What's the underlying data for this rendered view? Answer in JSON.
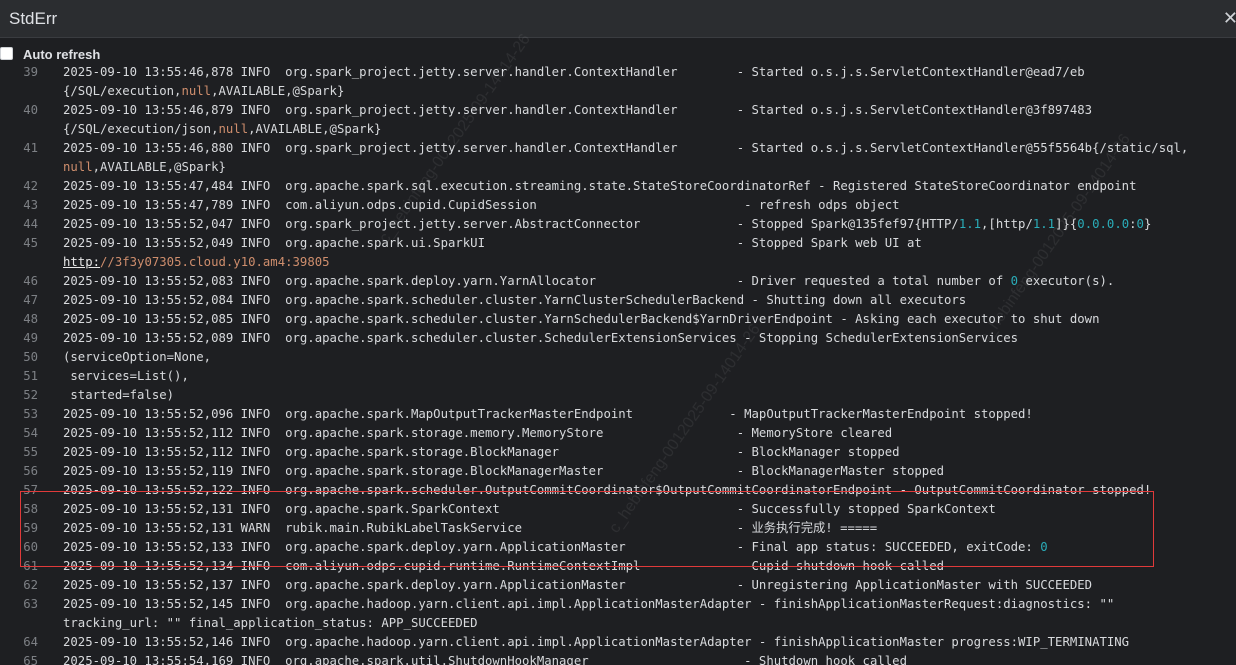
{
  "window": {
    "title": "StdErr",
    "close_glyph": "✕"
  },
  "toolbar": {
    "auto_refresh_label": "Auto refresh",
    "auto_refresh_checked": false
  },
  "watermark": {
    "text": "c_hebinfeng-0012025-09-14014-26"
  },
  "log_lines": [
    {
      "ln": "39",
      "html": "2025-09-10 13:55:46,878 INFO  org.spark_project.jetty.server.handler.ContextHandler        - Started o.s.j.s.ServletContextHandler@ead7/eb"
    },
    {
      "ln": "",
      "html": "{/SQL/execution,<span class=\"kw\">null</span>,AVAILABLE,@Spark}"
    },
    {
      "ln": "40",
      "html": "2025-09-10 13:55:46,879 INFO  org.spark_project.jetty.server.handler.ContextHandler        - Started o.s.j.s.ServletContextHandler@3f897483"
    },
    {
      "ln": "",
      "html": "{/SQL/execution/json,<span class=\"kw\">null</span>,AVAILABLE,@Spark}"
    },
    {
      "ln": "41",
      "html": "2025-09-10 13:55:46,880 INFO  org.spark_project.jetty.server.handler.ContextHandler        - Started o.s.j.s.ServletContextHandler@55f5564b{/static/sql,"
    },
    {
      "ln": "",
      "html": "<span class=\"kw\">null</span>,AVAILABLE,@Spark}"
    },
    {
      "ln": "42",
      "html": "2025-09-10 13:55:47,484 INFO  org.apache.spark.sql.execution.streaming.state.StateStoreCoordinatorRef - Registered StateStoreCoordinator endpoint"
    },
    {
      "ln": "43",
      "html": "2025-09-10 13:55:47,789 INFO  com.aliyun.odps.cupid.CupidSession                            - refresh odps object"
    },
    {
      "ln": "44",
      "html": "2025-09-10 13:55:52,047 INFO  org.spark_project.jetty.server.AbstractConnector             - Stopped Spark@135fef97{HTTP/<span class=\"num\">1.1</span>,[http/<span class=\"num\">1.1</span>]}{<span class=\"num\">0.0.0.0</span>:<span class=\"num\">0</span>}"
    },
    {
      "ln": "45",
      "html": "2025-09-10 13:55:52,049 INFO  org.apache.spark.ui.SparkUI                                  - Stopped Spark web UI at"
    },
    {
      "ln": "",
      "html": "<span class=\"url\">http:</span><span class=\"kw\">//3f3y07305.cloud.y10.am4:39805</span>"
    },
    {
      "ln": "46",
      "html": "2025-09-10 13:55:52,083 INFO  org.apache.spark.deploy.yarn.YarnAllocator                   - Driver requested a total number of <span class=\"num\">0</span> executor(s)."
    },
    {
      "ln": "47",
      "html": "2025-09-10 13:55:52,084 INFO  org.apache.spark.scheduler.cluster.YarnClusterSchedulerBackend - Shutting down all executors"
    },
    {
      "ln": "48",
      "html": "2025-09-10 13:55:52,085 INFO  org.apache.spark.scheduler.cluster.YarnSchedulerBackend$YarnDriverEndpoint - Asking each executor to shut down"
    },
    {
      "ln": "49",
      "html": "2025-09-10 13:55:52,089 INFO  org.apache.spark.scheduler.cluster.SchedulerExtensionServices - Stopping SchedulerExtensionServices"
    },
    {
      "ln": "50",
      "html": "(serviceOption=None,"
    },
    {
      "ln": "51",
      "html": " services=List(),"
    },
    {
      "ln": "52",
      "html": " started=false)"
    },
    {
      "ln": "53",
      "html": "2025-09-10 13:55:52,096 INFO  org.apache.spark.MapOutputTrackerMasterEndpoint             - MapOutputTrackerMasterEndpoint stopped!"
    },
    {
      "ln": "54",
      "html": "2025-09-10 13:55:52,112 INFO  org.apache.spark.storage.memory.MemoryStore                  - MemoryStore cleared"
    },
    {
      "ln": "55",
      "html": "2025-09-10 13:55:52,112 INFO  org.apache.spark.storage.BlockManager                        - BlockManager stopped"
    },
    {
      "ln": "56",
      "html": "2025-09-10 13:55:52,119 INFO  org.apache.spark.storage.BlockManagerMaster                  - BlockManagerMaster stopped"
    },
    {
      "ln": "57",
      "html": "2025-09-10 13:55:52,122 INFO  org.apache.spark.scheduler.OutputCommitCoordinator$OutputCommitCoordinatorEndpoint - OutputCommitCoordinator stopped!"
    },
    {
      "ln": "58",
      "html": "2025-09-10 13:55:52,131 INFO  org.apache.spark.SparkContext                                - Successfully stopped SparkContext"
    },
    {
      "ln": "59",
      "html": "2025-09-10 13:55:52,131 WARN  rubik.main.RubikLabelTaskService                             - 业务执行完成! ====="
    },
    {
      "ln": "60",
      "html": "2025-09-10 13:55:52,133 INFO  org.apache.spark.deploy.yarn.ApplicationMaster               - Final app status: SUCCEEDED, exitCode: <span class=\"num\">0</span>"
    },
    {
      "ln": "61",
      "html": "2025-09-10 13:55:52,134 INFO  com.aliyun.odps.cupid.runtime.RuntimeContextImpl             - Cupid shutdown hook called"
    },
    {
      "ln": "62",
      "html": "2025-09-10 13:55:52,137 INFO  org.apache.spark.deploy.yarn.ApplicationMaster               - Unregistering ApplicationMaster with SUCCEEDED"
    },
    {
      "ln": "63",
      "html": "2025-09-10 13:55:52,145 INFO  org.apache.hadoop.yarn.client.api.impl.ApplicationMasterAdapter - finishApplicationMasterRequest:diagnostics: \"\""
    },
    {
      "ln": "",
      "html": "tracking_url: \"\" final_application_status: APP_SUCCEEDED"
    },
    {
      "ln": "64",
      "html": "2025-09-10 13:55:52,146 INFO  org.apache.hadoop.yarn.client.api.impl.ApplicationMasterAdapter - finishApplicationMaster progress:WIP_TERMINATING"
    },
    {
      "ln": "65",
      "html": "2025-09-10 13:55:54,169 INFO  org.apache.spark.util.ShutdownHookManager                     - Shutdown hook called"
    }
  ],
  "highlight": {
    "color": "#e03a3a",
    "lines": [
      "58",
      "59",
      "60"
    ]
  }
}
